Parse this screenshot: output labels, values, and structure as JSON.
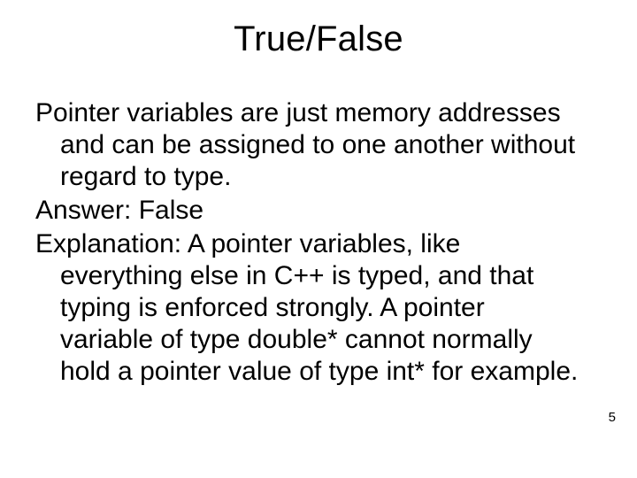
{
  "slide": {
    "title": "True/False",
    "question": "Pointer variables are just memory addresses and can be assigned to one another without regard to type.",
    "answer_label": "Answer:",
    "answer_value": "False",
    "explanation_label": "Explanation:",
    "explanation_text": "A pointer variables, like everything else in C++ is typed, and that typing is enforced strongly. A pointer variable of type double* cannot normally hold a pointer value of type int* for example.",
    "page_number": "5"
  }
}
